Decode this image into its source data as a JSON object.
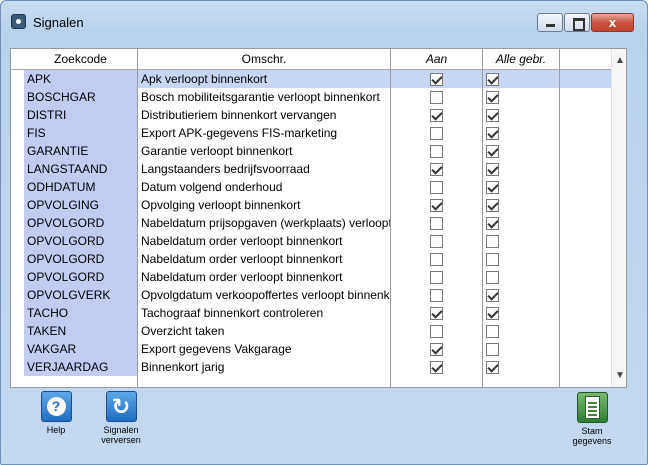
{
  "window": {
    "title": "Signalen",
    "close_label": "x"
  },
  "grid": {
    "columns": {
      "code": "Zoekcode",
      "desc": "Omschr.",
      "aan": "Aan",
      "alle": "Alle gebr."
    },
    "rows": [
      {
        "code": "APK",
        "desc": "Apk verloopt binnenkort",
        "aan": true,
        "alle": true,
        "selected": true
      },
      {
        "code": "BOSCHGAR",
        "desc": "Bosch mobiliteitsgarantie verloopt binnenkort",
        "aan": false,
        "alle": true
      },
      {
        "code": "DISTRI",
        "desc": "Distributieriem binnenkort vervangen",
        "aan": true,
        "alle": true
      },
      {
        "code": "FIS",
        "desc": "Export APK-gegevens FIS-marketing",
        "aan": false,
        "alle": true
      },
      {
        "code": "GARANTIE",
        "desc": "Garantie verloopt binnenkort",
        "aan": false,
        "alle": true
      },
      {
        "code": "LANGSTAAND",
        "desc": "Langstaanders bedrijfsvoorraad",
        "aan": true,
        "alle": true
      },
      {
        "code": "ODHDATUM",
        "desc": "Datum volgend onderhoud",
        "aan": false,
        "alle": true
      },
      {
        "code": "OPVOLGING",
        "desc": "Opvolging verloopt binnenkort",
        "aan": true,
        "alle": true
      },
      {
        "code": "OPVOLGORD",
        "desc": "Nabeldatum prijsopgaven (werkplaats) verloopt",
        "aan": false,
        "alle": true
      },
      {
        "code": "OPVOLGORD",
        "desc": "Nabeldatum order verloopt binnenkort",
        "aan": false,
        "alle": false
      },
      {
        "code": "OPVOLGORD",
        "desc": "Nabeldatum order verloopt binnenkort",
        "aan": false,
        "alle": false
      },
      {
        "code": "OPVOLGORD",
        "desc": "Nabeldatum order verloopt binnenkort",
        "aan": false,
        "alle": false
      },
      {
        "code": "OPVOLGVERK",
        "desc": "Opvolgdatum verkoopoffertes verloopt binnenkort",
        "aan": false,
        "alle": true
      },
      {
        "code": "TACHO",
        "desc": "Tachograaf binnenkort controleren",
        "aan": true,
        "alle": true
      },
      {
        "code": "TAKEN",
        "desc": "Overzicht taken",
        "aan": false,
        "alle": false
      },
      {
        "code": "VAKGAR",
        "desc": "Export gegevens Vakgarage",
        "aan": true,
        "alle": false
      },
      {
        "code": "VERJAARDAG",
        "desc": "Binnenkort jarig",
        "aan": true,
        "alle": true
      }
    ]
  },
  "toolbar": {
    "help_label": "Help",
    "refresh_label_line1": "Signalen",
    "refresh_label_line2": "verversen",
    "stam_label_line1": "Stam",
    "stam_label_line2": "gegevens"
  }
}
